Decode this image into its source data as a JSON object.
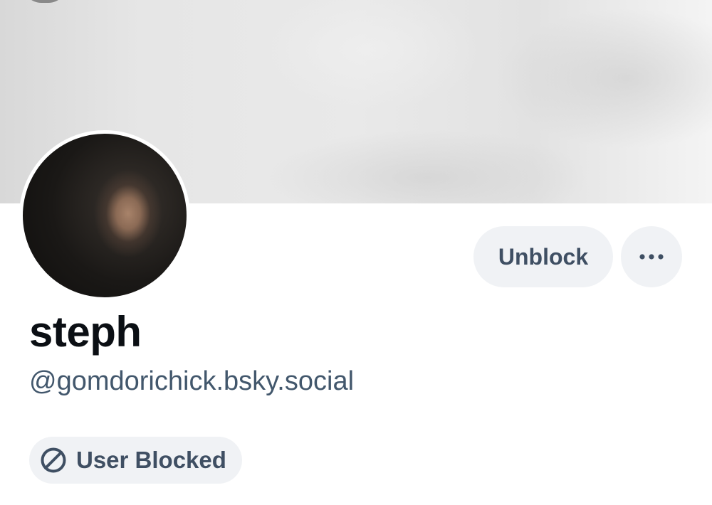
{
  "profile": {
    "display_name": "steph",
    "handle": "@gomdorichick.bsky.social",
    "blocked_badge_label": "User Blocked"
  },
  "actions": {
    "unblock_label": "Unblock",
    "more_icon": "ellipsis-horizontal-icon"
  },
  "icons": {
    "blocked": "circle-slash-icon"
  },
  "colors": {
    "button_bg": "#f0f2f5",
    "button_text": "#3f4f63",
    "handle_text": "#42576c",
    "name_text": "#0b0f14"
  }
}
